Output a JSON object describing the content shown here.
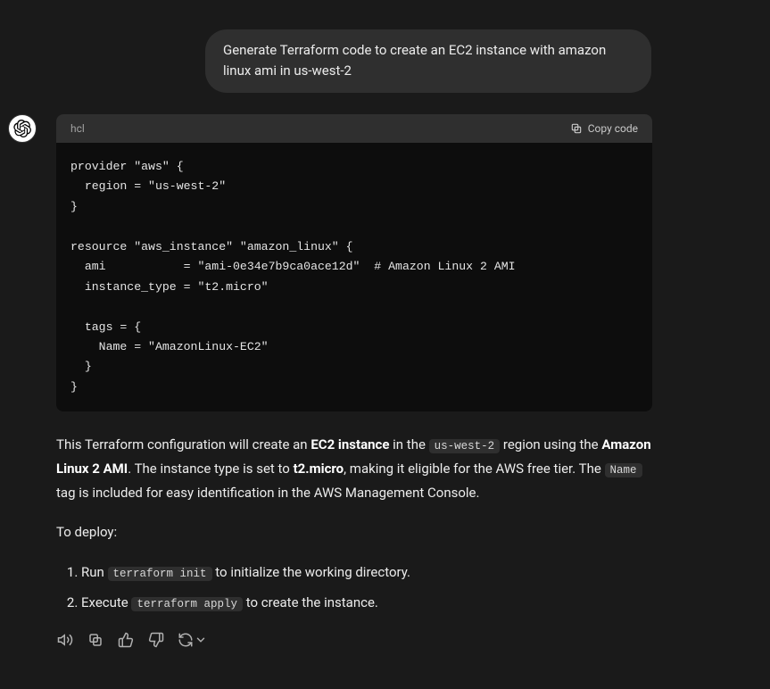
{
  "user_message": "Generate Terraform code to create an EC2 instance with amazon linux ami in us-west-2",
  "code": {
    "lang": "hcl",
    "copy_label": "Copy code",
    "content": "provider \"aws\" {\n  region = \"us-west-2\"\n}\n\nresource \"aws_instance\" \"amazon_linux\" {\n  ami           = \"ami-0e34e7b9ca0ace12d\"  # Amazon Linux 2 AMI\n  instance_type = \"t2.micro\"\n\n  tags = {\n    Name = \"AmazonLinux-EC2\"\n  }\n}"
  },
  "explanation": {
    "p1_pre": "This Terraform configuration will create an ",
    "b1": "EC2 instance",
    "p1_mid1": " in the ",
    "c1": "us-west-2",
    "p1_mid2": " region using the ",
    "b2": "Amazon Linux 2 AMI",
    "p1_mid3": ". The instance type is set to ",
    "b3": "t2.micro",
    "p1_mid4": ", making it eligible for the AWS free tier. The ",
    "c2": "Name",
    "p1_end": " tag is included for easy identification in the AWS Management Console.",
    "deploy_intro": "To deploy:",
    "steps": {
      "s1_pre": "Run ",
      "s1_code": "terraform init",
      "s1_post": " to initialize the working directory.",
      "s2_pre": "Execute ",
      "s2_code": "terraform apply",
      "s2_post": " to create the instance."
    }
  }
}
